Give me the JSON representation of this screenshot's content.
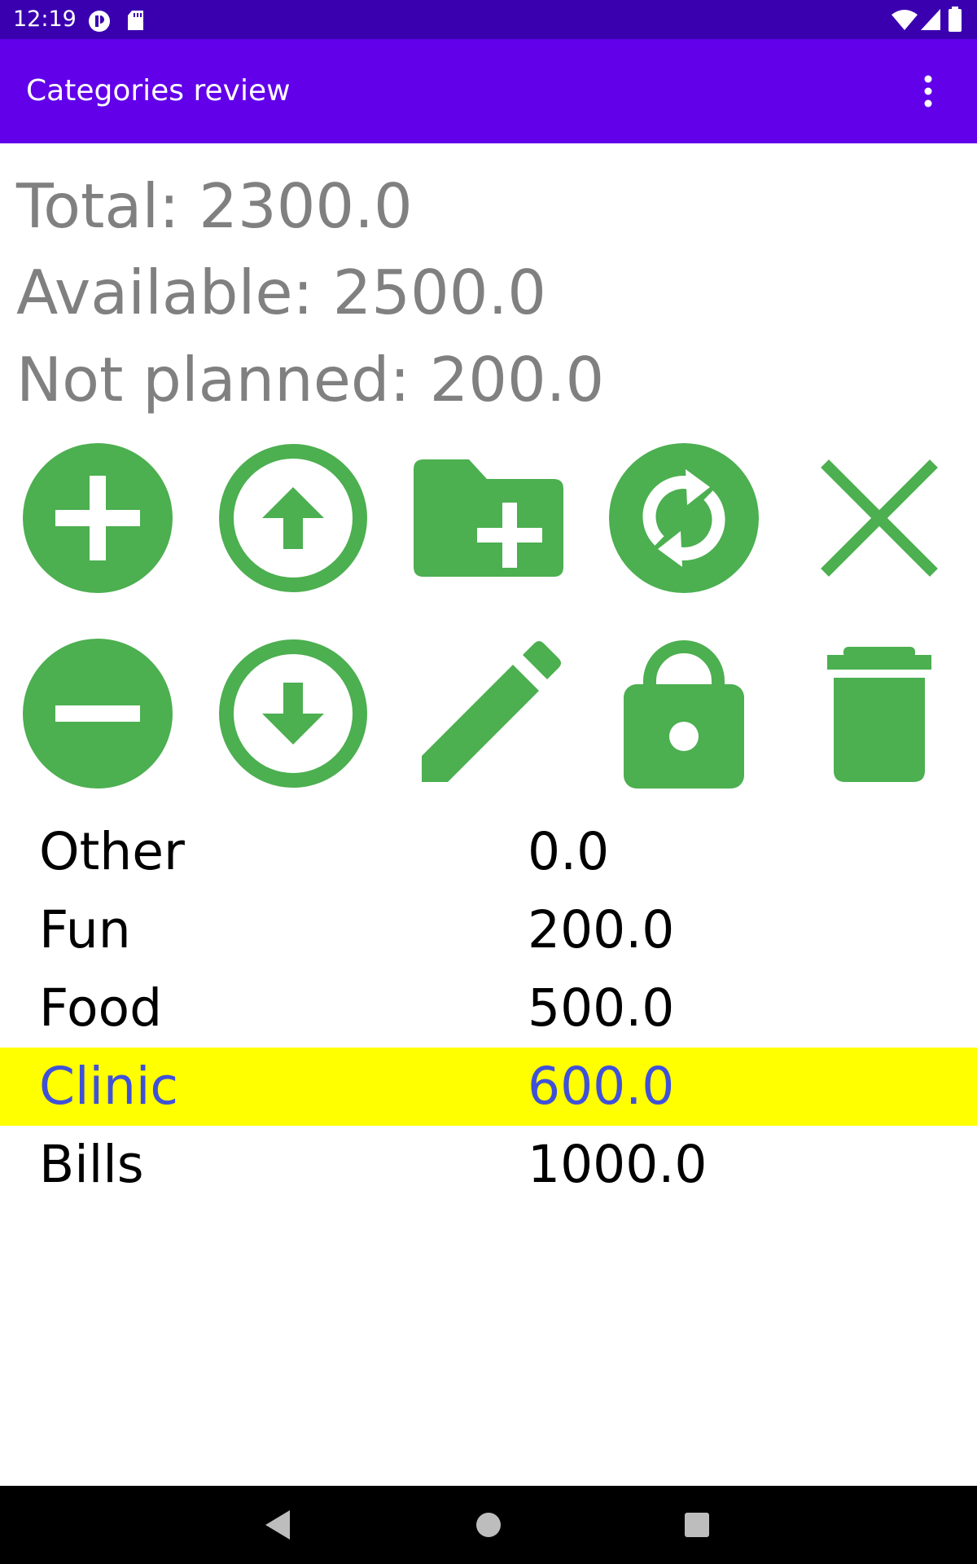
{
  "status_bar": {
    "time": "12:19",
    "icons": [
      "notification-app-icon",
      "sd-card-icon",
      "wifi-icon",
      "signal-icon",
      "battery-icon"
    ]
  },
  "app_bar": {
    "title": "Categories review",
    "menu_icon": "more-vert-icon"
  },
  "summary": {
    "total": "Total: 2300.0",
    "available": "Available: 2500.0",
    "not_planned": "Not planned: 200.0"
  },
  "actions": {
    "row1": [
      "add-icon",
      "arrow-up-circle-icon",
      "folder-add-icon",
      "sync-icon",
      "close-icon"
    ],
    "row2": [
      "remove-icon",
      "arrow-down-circle-icon",
      "edit-pencil-icon",
      "lock-icon",
      "delete-icon"
    ]
  },
  "colors": {
    "status_bar": "#3a00b0",
    "app_bar": "#6200ea",
    "action_green": "#4caf50",
    "summary_text": "#808080",
    "selected_row_bg": "#ffff00",
    "selected_row_text": "#3f51d9",
    "nav_bar": "#000000"
  },
  "categories": [
    {
      "name": "Other",
      "value": "0.0",
      "selected": false
    },
    {
      "name": "Fun",
      "value": "200.0",
      "selected": false
    },
    {
      "name": "Food",
      "value": "500.0",
      "selected": false
    },
    {
      "name": "Clinic",
      "value": "600.0",
      "selected": true
    },
    {
      "name": "Bills",
      "value": "1000.0",
      "selected": false
    }
  ],
  "nav_bar": {
    "icons": [
      "back-icon",
      "home-icon",
      "recents-icon"
    ]
  }
}
